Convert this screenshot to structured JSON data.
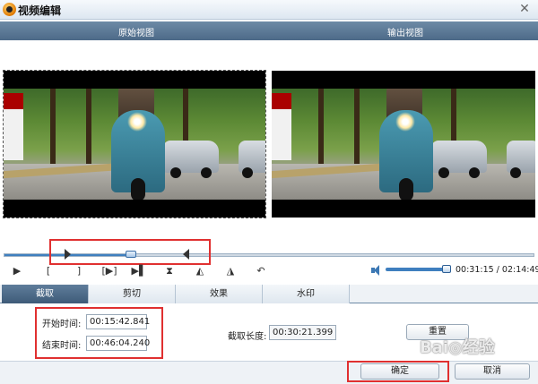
{
  "window": {
    "title": "视频编辑",
    "close_label": "✕"
  },
  "views": {
    "original_label": "原始视图",
    "output_label": "输出视图"
  },
  "playback": {
    "progress_fraction": 0.24,
    "trim_start_fraction": 0.115,
    "trim_end_fraction": 0.35,
    "volume_fraction": 0.95,
    "time_readout": "00:31:15 / 02:14:49",
    "buttons": [
      "▶",
      "[",
      "]",
      "[▶]",
      "▶▌",
      "⧗",
      "◭",
      "◮",
      "↶"
    ]
  },
  "tabs": [
    {
      "label": "截取",
      "active": true
    },
    {
      "label": "剪切",
      "active": false
    },
    {
      "label": "效果",
      "active": false
    },
    {
      "label": "水印",
      "active": false
    }
  ],
  "trim": {
    "start_label": "开始时间:",
    "start_value": "00:15:42.841",
    "end_label": "结束时间:",
    "end_value": "00:46:04.240",
    "length_label": "截取长度:",
    "length_value": "00:30:21.399",
    "reset_label": "重置"
  },
  "footer": {
    "ok_label": "确定",
    "cancel_label": "取消"
  },
  "watermark_text": "Bai◎经验",
  "colors": {
    "header": "#5a7896",
    "accent": "#3f7fbf",
    "annotation": "#e03030"
  }
}
